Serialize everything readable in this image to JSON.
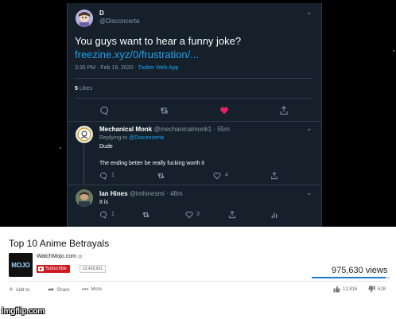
{
  "twitter": {
    "main_tweet": {
      "name": "D",
      "handle": "@Disconcerta",
      "text": "You guys want to hear a funny joke?",
      "link": "freezine.xyz/0/frustration/...",
      "time": "3:35 PM · Feb 19, 2020 · ",
      "source": "Twitter Web App",
      "likes_count": "5",
      "likes_label": "Likes"
    },
    "replies": [
      {
        "name": "Mechanical Monk",
        "handle": "@mechanicalmonk1 · 55m",
        "replying_prefix": "Replying to ",
        "replying_to": "@Disconcerta",
        "lines": [
          "Dude",
          "The ending better be really fucking worth it"
        ],
        "reply_count": "1",
        "like_count": "4"
      },
      {
        "name": "Ian Hines",
        "handle": "@imhinesmi · 48m",
        "lines": [
          "It is"
        ],
        "reply_count": "1",
        "like_count": "3"
      }
    ],
    "icons": [
      "reply-icon",
      "retweet-icon",
      "heart-icon",
      "share-icon",
      "chevron-down-icon",
      "analytics-icon"
    ],
    "colors": {
      "background": "#15202b",
      "link": "#1da1f2",
      "heart": "#e0245e"
    }
  },
  "youtube": {
    "title": "Top 10 Anime Betrayals",
    "channel_name": "WatchMojo.com",
    "logo_text": "MOJO",
    "subscribe_label": "Subscribe",
    "subscriber_count": "12,419,921",
    "views": "975,630 views",
    "like_ratio": 0.95,
    "actions": {
      "add_to": "Add to",
      "share": "Share",
      "more": "More"
    },
    "likes": "12,816",
    "dislikes": "528",
    "colors": {
      "subscribe": "#cc181e",
      "bar": "#1e77d3"
    }
  },
  "watermark": "imgflip.com"
}
